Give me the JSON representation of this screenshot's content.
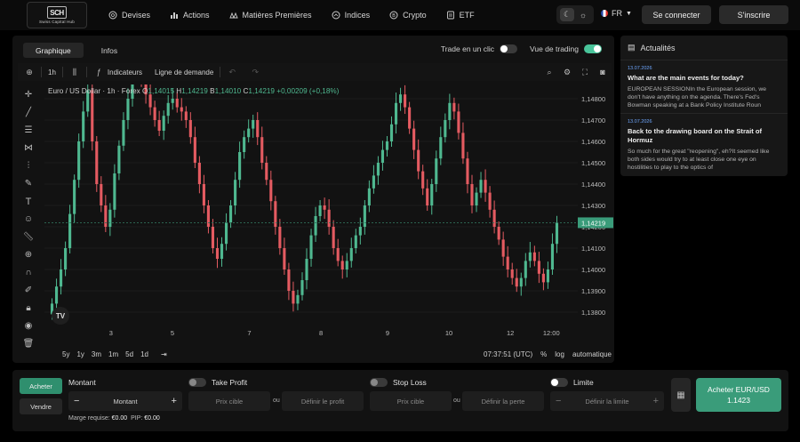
{
  "brand": {
    "logo_mark": "SCH",
    "name": "Swiss Capital Hub"
  },
  "nav": [
    {
      "label": "Devises",
      "icon": "coins-icon"
    },
    {
      "label": "Actions",
      "icon": "bar-chart-icon"
    },
    {
      "label": "Matières Premières",
      "icon": "commodities-icon"
    },
    {
      "label": "Indices",
      "icon": "indices-icon"
    },
    {
      "label": "Crypto",
      "icon": "bitcoin-icon"
    },
    {
      "label": "ETF",
      "icon": "etf-icon"
    }
  ],
  "header": {
    "language": "FR",
    "login": "Se connecter",
    "signup": "S'inscrire"
  },
  "panel": {
    "tabs": [
      {
        "label": "Graphique",
        "active": true
      },
      {
        "label": "Infos",
        "active": false
      }
    ],
    "toggle_one_click": {
      "label": "Trade en un clic",
      "on": false
    },
    "toggle_trading_view": {
      "label": "Vue de trading",
      "on": true
    }
  },
  "toolbar": {
    "timeframe": "1h",
    "indicators": "Indicateurs",
    "line_demand": "Ligne de demande"
  },
  "ohlc": {
    "title": "Euro / US Dollar · 1h · Forex",
    "o_label": "O",
    "o": "1,14015",
    "h_label": "H",
    "h": "1,14219",
    "b_label": "B",
    "b": "1,14010",
    "c_label": "C",
    "c": "1,14219",
    "change": "+0,00209 (+0,18%)"
  },
  "chart_data": {
    "type": "candlestick",
    "symbol": "Euro / US Dollar · 1h · Forex",
    "y_ticks": [
      "1,14800",
      "1,14700",
      "1,14600",
      "1,14500",
      "1,14400",
      "1,14300",
      "1,14200",
      "1,14100",
      "1,14000",
      "1,13900",
      "1,13800"
    ],
    "ylim": [
      1.1375,
      1.1485
    ],
    "x_ticks": [
      "3",
      "5",
      "7",
      "8",
      "9",
      "10",
      "12",
      "12:00"
    ],
    "current_price": "1,14219",
    "current_value": 1.14219,
    "up_color": "#4fb890",
    "down_color": "#e45b61",
    "closes": [
      1.1384,
      1.1392,
      1.14,
      1.141,
      1.1426,
      1.1442,
      1.146,
      1.1474,
      1.1484,
      1.146,
      1.144,
      1.143,
      1.142,
      1.1428,
      1.1445,
      1.1458,
      1.147,
      1.148,
      1.149,
      1.1492,
      1.1488,
      1.1482,
      1.1476,
      1.147,
      1.1465,
      1.1472,
      1.1478,
      1.148,
      1.1476,
      1.1474,
      1.147,
      1.1462,
      1.145,
      1.144,
      1.143,
      1.142,
      1.141,
      1.1405,
      1.1412,
      1.1422,
      1.143,
      1.1442,
      1.1455,
      1.1462,
      1.1466,
      1.147,
      1.1462,
      1.145,
      1.1442,
      1.1432,
      1.142,
      1.141,
      1.14,
      1.139,
      1.1384,
      1.1388,
      1.1395,
      1.1405,
      1.1416,
      1.1425,
      1.143,
      1.1428,
      1.142,
      1.141,
      1.1404,
      1.14,
      1.1404,
      1.141,
      1.1416,
      1.142,
      1.143,
      1.1438,
      1.1444,
      1.145,
      1.1456,
      1.146,
      1.1468,
      1.1478,
      1.1482,
      1.1476,
      1.1466,
      1.1456,
      1.1446,
      1.1438,
      1.143,
      1.144,
      1.1452,
      1.1462,
      1.147,
      1.1478,
      1.1474,
      1.1464,
      1.1452,
      1.144,
      1.143,
      1.1436,
      1.1442,
      1.1436,
      1.1428,
      1.142,
      1.1414,
      1.1406,
      1.14,
      1.1396,
      1.1392,
      1.1396,
      1.1404,
      1.1408,
      1.1404,
      1.1398,
      1.1394,
      1.14,
      1.1412,
      1.1422
    ],
    "opens_offset": 0.0005
  },
  "chart_footer": {
    "ranges": [
      "5y",
      "1y",
      "3m",
      "1m",
      "5d",
      "1d"
    ],
    "time": "07:37:51 (UTC)",
    "percent": "%",
    "log": "log",
    "auto": "automatique"
  },
  "news": {
    "title": "Actualités",
    "items": [
      {
        "date": "13.07.2026",
        "title": "What are the main events for today?",
        "body": "EUROPEAN SESSIONIn the European session, we don't have anything on the agenda. There's Fed's Bowman speaking at a Bank Policy Institute Roun"
      },
      {
        "date": "13.07.2026",
        "title": "Back to the drawing board on the Strait of Hormuz",
        "body": "So much for the great \"reopening\", eh?It seemed like both sides would try to at least close one eye on hostilities to play to the optics of"
      }
    ]
  },
  "trade": {
    "buy": "Acheter",
    "sell": "Vendre",
    "amount_label": "Montant",
    "amount_value": "Montant",
    "take_profit": "Take Profit",
    "stop_loss": "Stop Loss",
    "limit": "Limite",
    "target_price": "Prix cible",
    "or": "ou",
    "define_profit": "Définir le profit",
    "define_loss": "Définir la perte",
    "define_limit": "Définir la limite",
    "margin_label": "Marge requise:",
    "margin_value": "€0.00",
    "pip_label": "PIP:",
    "pip_value": "€0.00",
    "cta_label": "Acheter EUR/USD",
    "cta_price": "1.1423"
  }
}
